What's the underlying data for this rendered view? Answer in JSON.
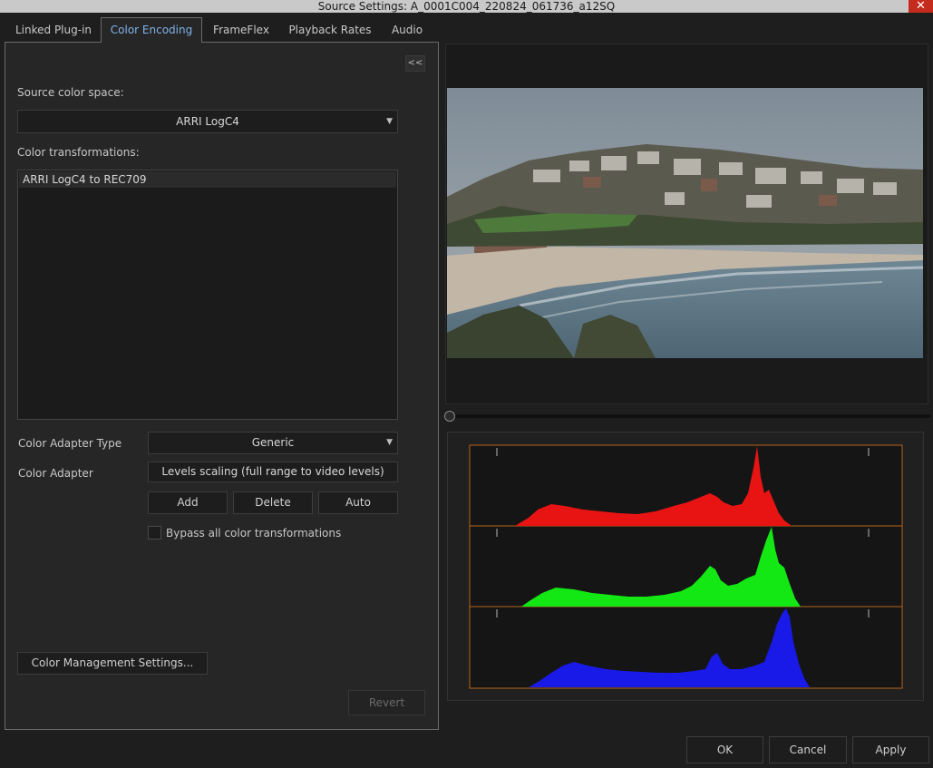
{
  "window": {
    "title": "Source Settings: A_0001C004_220824_061736_a12SQ",
    "close_glyph": "✕"
  },
  "tabs": [
    {
      "label": "Linked Plug-in",
      "active": false
    },
    {
      "label": "Color Encoding",
      "active": true
    },
    {
      "label": "FrameFlex",
      "active": false
    },
    {
      "label": "Playback Rates",
      "active": false
    },
    {
      "label": "Audio",
      "active": false
    }
  ],
  "panel": {
    "collapse_label": "<<",
    "source_color_space_label": "Source color space:",
    "source_color_space_value": "ARRI LogC4",
    "color_transformations_label": "Color transformations:",
    "transformations": [
      "ARRI LogC4 to REC709"
    ],
    "color_adapter_type_label": "Color Adapter Type",
    "color_adapter_type_value": "Generic",
    "color_adapter_label": "Color Adapter",
    "color_adapter_value": "Levels scaling (full range to video levels)",
    "add_label": "Add",
    "delete_label": "Delete",
    "auto_label": "Auto",
    "bypass_label": "Bypass all color transformations",
    "bypass_checked": false,
    "color_management_label": "Color Management Settings...",
    "revert_label": "Revert"
  },
  "footer": {
    "ok_label": "OK",
    "cancel_label": "Cancel",
    "apply_label": "Apply"
  },
  "histogram": {
    "colors": {
      "red": "#e81414",
      "green": "#14e814",
      "blue": "#1a1ae8",
      "frame": "#b8621a"
    }
  }
}
